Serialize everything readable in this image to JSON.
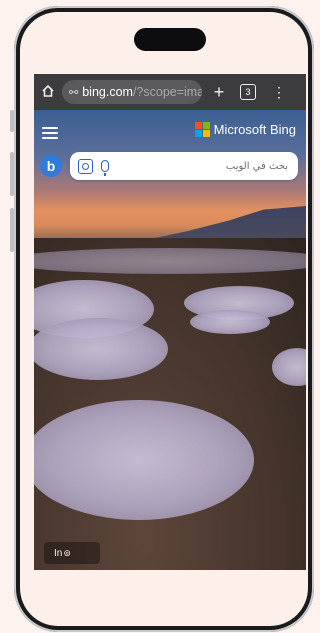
{
  "browser": {
    "url_host": "bing.com",
    "url_path": "/?scope=imag",
    "tab_count": "3"
  },
  "bing": {
    "brand": "Microsoft Bing",
    "logo_letter": "b",
    "search_placeholder": "بحث في الويب",
    "info_label": "In",
    "logo_colors": [
      "#f25022",
      "#7fba00",
      "#00a4ef",
      "#ffb900"
    ]
  },
  "icons": {
    "home": "home-icon",
    "site_settings": "tune-icon",
    "new_tab": "plus-icon",
    "tabs": "tab-count-icon",
    "menu": "more-vert-icon",
    "hamburger": "hamburger-icon",
    "visual_search": "camera-search-icon",
    "mic": "mic-icon",
    "location": "location-pin-icon"
  }
}
